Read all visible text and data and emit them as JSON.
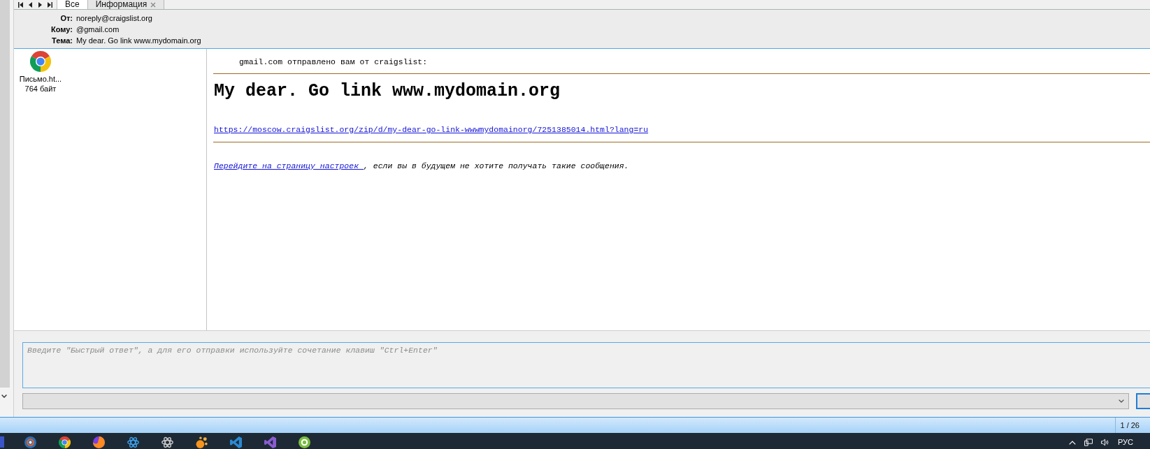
{
  "tabs": [
    {
      "label": "Все",
      "selected": true,
      "closable": false
    },
    {
      "label": "Информация",
      "selected": false,
      "closable": true
    }
  ],
  "header": {
    "fields": [
      {
        "label": "От:",
        "value": "noreply@craigslist.org"
      },
      {
        "label": "Кому:",
        "value": "@gmail.com"
      },
      {
        "label": "Тема:",
        "value": "My dear. Go link www.mydomain.org"
      }
    ]
  },
  "attachments": [
    {
      "name": "Письмо.ht...",
      "size": "764 байт"
    }
  ],
  "message": {
    "intro": "gmail.com отправлено вам от craigslist:",
    "heading": "My dear. Go link www.mydomain.org",
    "link": "https://moscow.craigslist.org/zip/d/my-dear-go-link-wwwmydomainorg/7251385014.html?lang=ru",
    "footer_link": "Перейдите на страницу настроек ",
    "footer_text": ", если вы в будущем не хотите получать такие сообщения."
  },
  "quick_reply": {
    "placeholder": "Введите \"Быстрый ответ\", а для его отправки используйте сочетание клавиш \"Ctrl+Enter\""
  },
  "status_bar": {
    "counter": "1 / 26"
  },
  "taskbar": {
    "language": "РУС"
  }
}
